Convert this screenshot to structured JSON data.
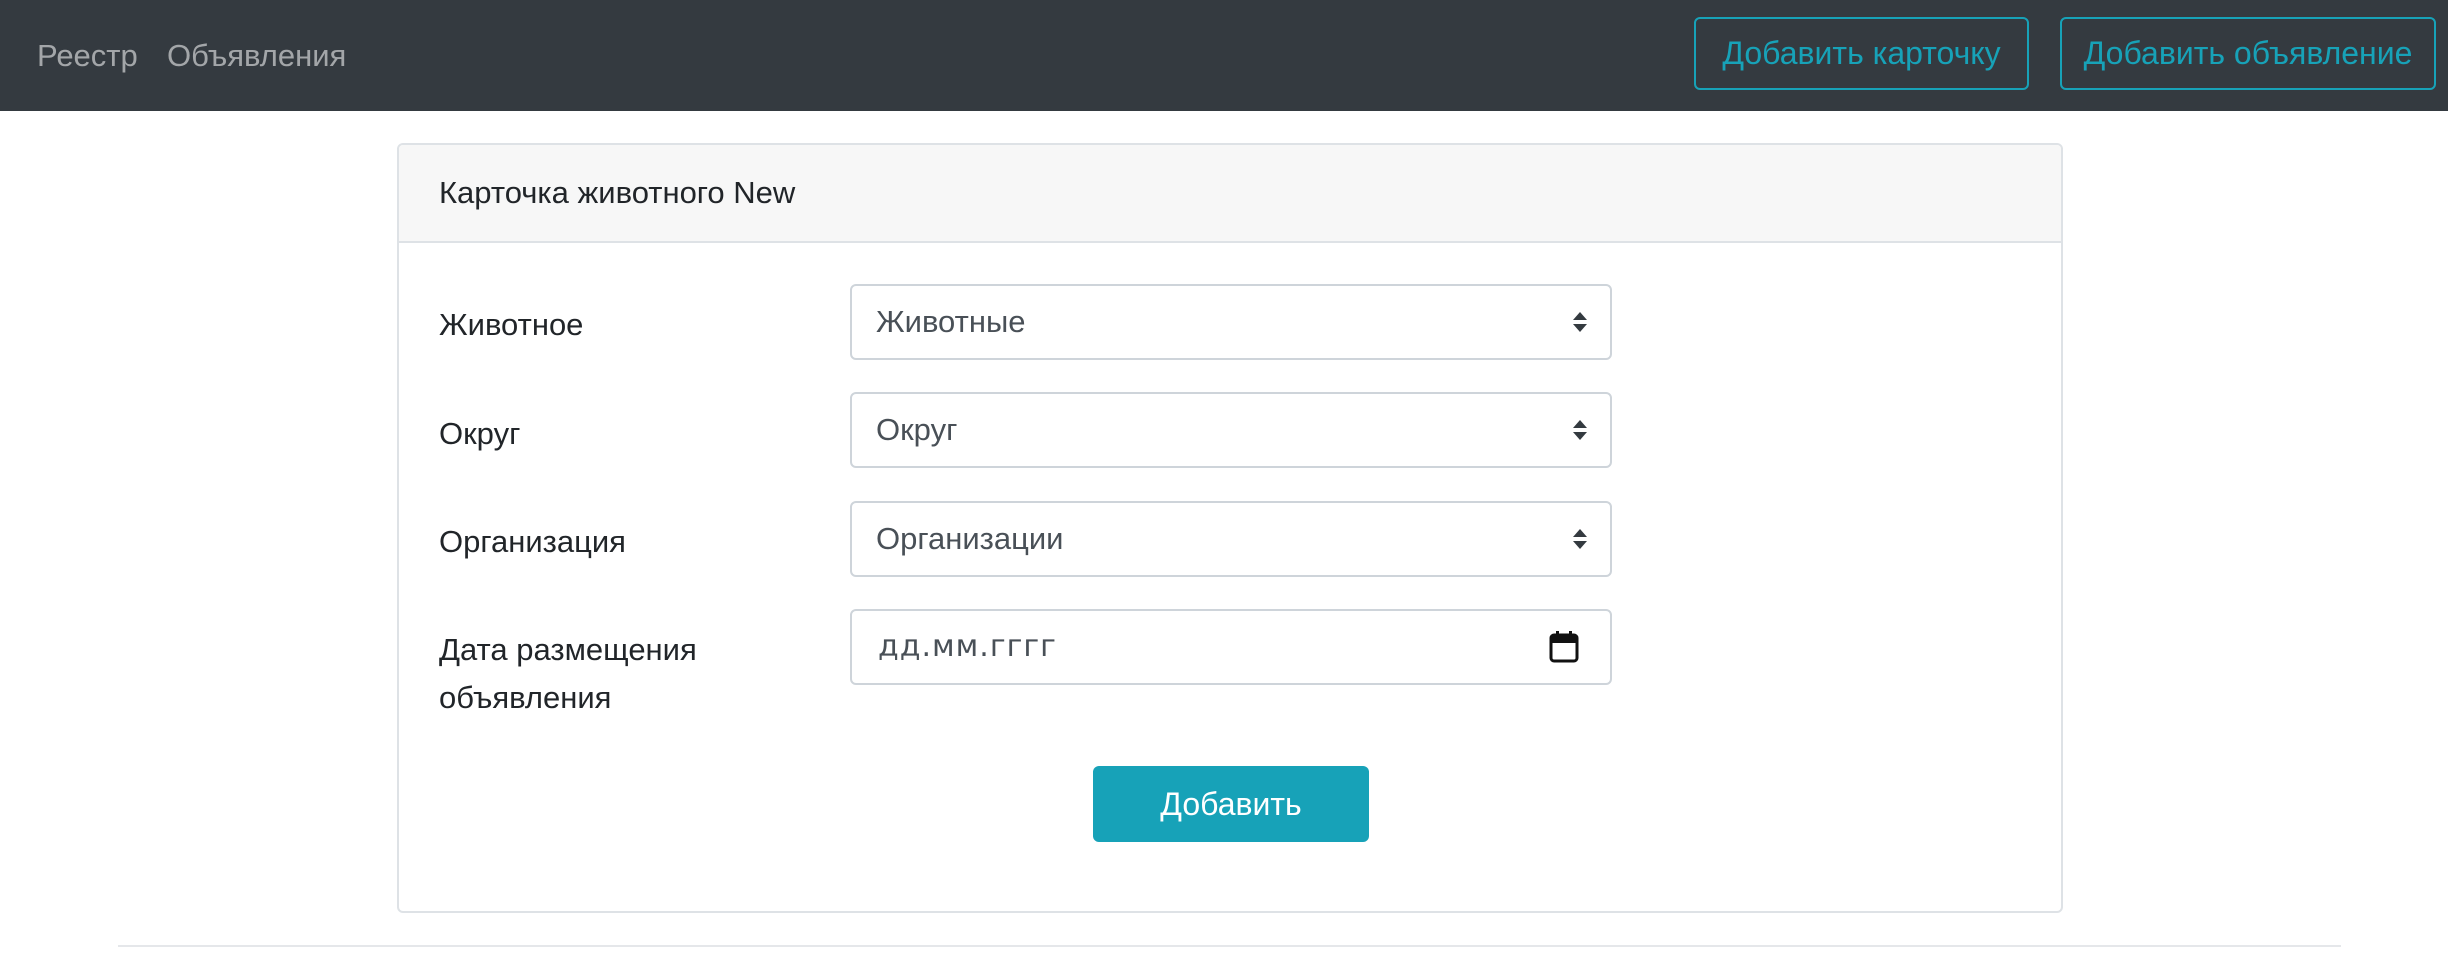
{
  "nav": {
    "links": [
      "Реестр",
      "Объявления"
    ],
    "add_card_label": "Добавить карточку",
    "add_ad_label": "Добавить объявление"
  },
  "card": {
    "title": "Карточка животного New",
    "fields": [
      {
        "label": "Животное",
        "value": "Животные",
        "type": "select"
      },
      {
        "label": "Округ",
        "value": "Округ",
        "type": "select"
      },
      {
        "label": "Организация",
        "value": "Организации",
        "type": "select"
      },
      {
        "label": "Дата размещения объявления",
        "placeholder": "дд.мм.гггг",
        "type": "date"
      }
    ],
    "submit_label": "Добавить"
  },
  "colors": {
    "navbar": "#343a40",
    "accent": "#17a2b8",
    "card_header": "#f7f7f7",
    "border": "#dee2e6"
  },
  "icons": [
    "sort-arrows-icon",
    "calendar-icon"
  ]
}
